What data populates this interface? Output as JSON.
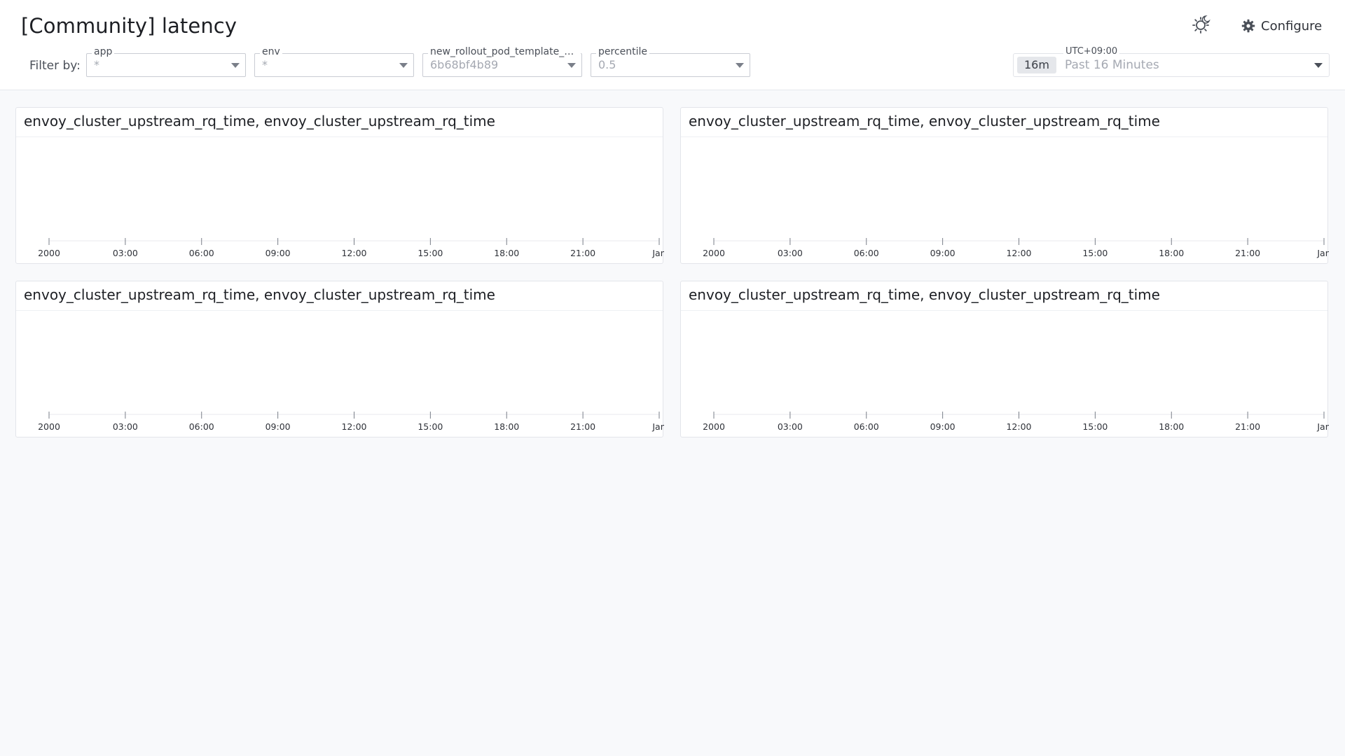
{
  "header": {
    "title": "[Community] latency",
    "filter_label": "Filter by:",
    "filters": [
      {
        "legend": "app",
        "value": "*"
      },
      {
        "legend": "env",
        "value": "*"
      },
      {
        "legend": "new_rollout_pod_template_ha...",
        "value": "6b68bf4b89"
      },
      {
        "legend": "percentile",
        "value": "0.5"
      }
    ],
    "timezone": "UTC+09:00",
    "time_badge": "16m",
    "time_range": "Past 16 Minutes",
    "configure_label": "Configure",
    "icons": {
      "theme": "theme-toggle-icon",
      "configure": "gear-icon",
      "dropdown": "chevron-down-icon"
    }
  },
  "panels": [
    {
      "title": "envoy_cluster_upstream_rq_time, envoy_cluster_upstream_rq_time"
    },
    {
      "title": "envoy_cluster_upstream_rq_time, envoy_cluster_upstream_rq_time"
    },
    {
      "title": "envoy_cluster_upstream_rq_time, envoy_cluster_upstream_rq_time"
    },
    {
      "title": "envoy_cluster_upstream_rq_time, envoy_cluster_upstream_rq_time"
    }
  ],
  "x_ticks": [
    "2000",
    "03:00",
    "06:00",
    "09:00",
    "12:00",
    "15:00",
    "18:00",
    "21:00",
    "Jan"
  ],
  "colors": {
    "accent": "#1d1f24",
    "muted": "#a5a9b2",
    "background": "#f8f9fb"
  }
}
